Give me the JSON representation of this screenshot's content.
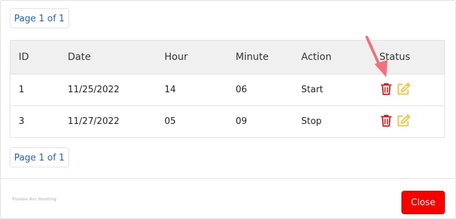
{
  "pager": {
    "top_label": "Page 1 of 1",
    "bottom_label": "Page 1 of 1"
  },
  "table": {
    "headers": [
      "ID",
      "Date",
      "Hour",
      "Minute",
      "Action",
      "Status"
    ],
    "rows": [
      {
        "id": "1",
        "date": "11/25/2022",
        "hour": "14",
        "minute": "06",
        "action": "Start"
      },
      {
        "id": "3",
        "date": "11/27/2022",
        "hour": "05",
        "minute": "09",
        "action": "Stop"
      }
    ],
    "icons": {
      "delete": "trash-icon",
      "edit": "edit-icon"
    }
  },
  "footer": {
    "brand": "Fusion Arc Hosting",
    "close_label": "Close"
  },
  "colors": {
    "pager_text": "#1a61d6",
    "delete_icon": "#e31313",
    "edit_icon": "#f2c12e",
    "close_button": "#f70000",
    "annotation_arrow": "#f2707a"
  }
}
